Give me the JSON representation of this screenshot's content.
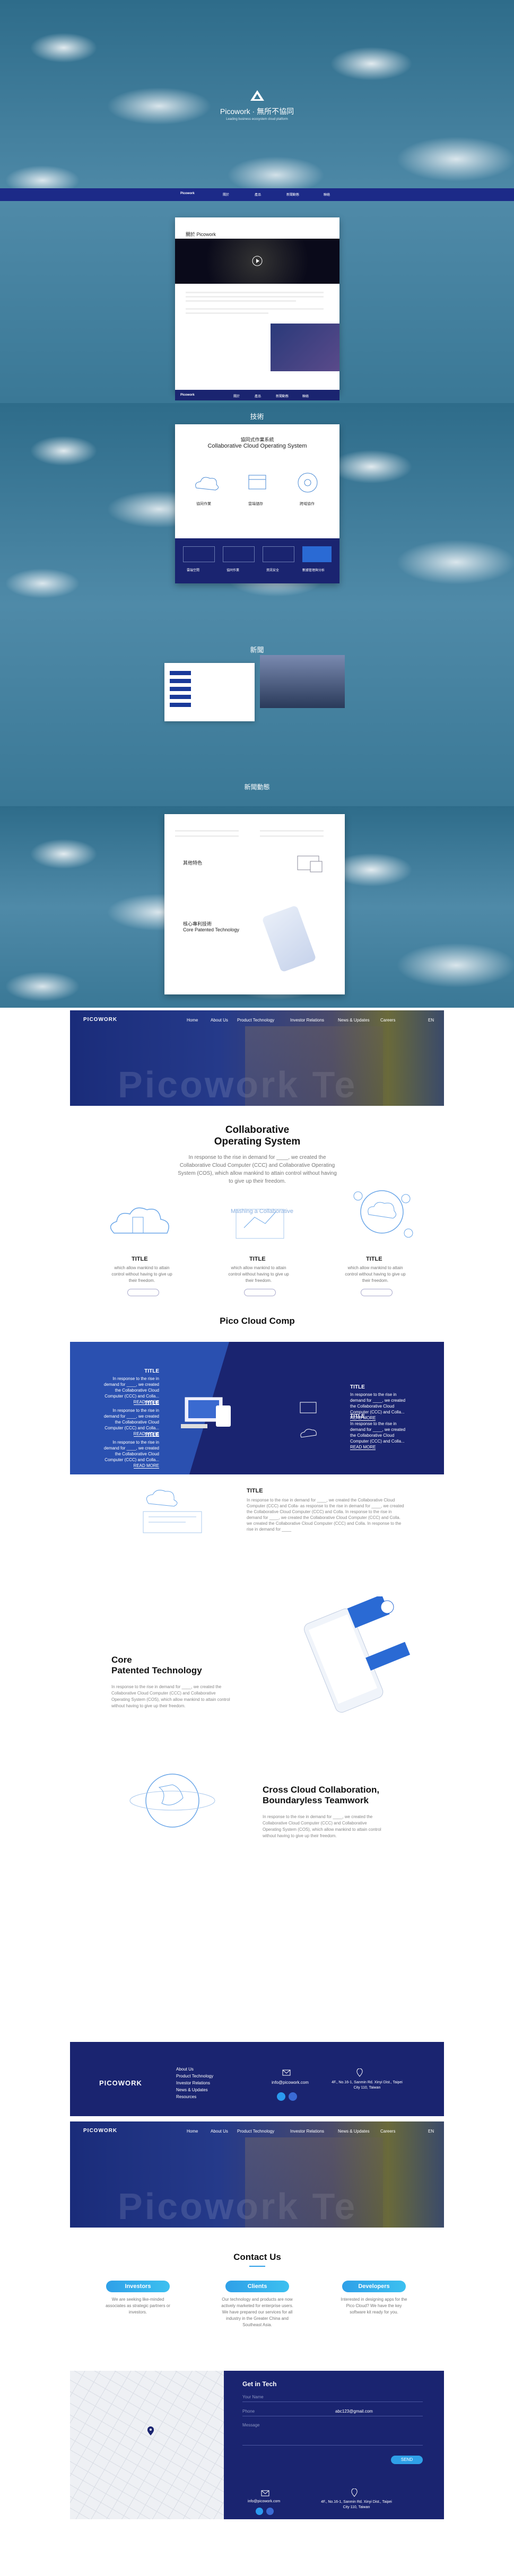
{
  "hero1": {
    "brand": "Picowork",
    "slogan": "無所不協同",
    "tagline": "Leading business ecosystem cloud platform"
  },
  "mini_nav": [
    "Picowork",
    "關於",
    "產品",
    "新聞動態",
    "聯絡"
  ],
  "about_title": "關於 Picowork",
  "tech_title": "技術",
  "cos": {
    "title_cn": "協同式作業系統",
    "title_en": "Collaborative Cloud Operating System",
    "cols": [
      "協同作業",
      "雲端儲存",
      "跨域協作"
    ],
    "tiles": [
      "雲端空間",
      "協同作業",
      "資訊安全",
      "數據管理與分析"
    ]
  },
  "news_title": "新聞",
  "news_bottom": "新聞動態",
  "mock4": {
    "h1": "其他特色",
    "h2_cn": "核心專利技術",
    "h2_en": "Core Patented Technology"
  },
  "nav": {
    "logo": "PICOWORK",
    "items": [
      "Home",
      "About Us",
      "Product Technology",
      "Investor Relations",
      "News & Updates",
      "Careers"
    ],
    "lang": "EN"
  },
  "hero_big": "Picowork Te",
  "cos2": {
    "title": "Collaborative Operating System",
    "desc": "In response to the rise in demand for ____, we created the Collaborative Cloud Computer (CCC) and Collaborative Operating System (COS), which allow mankind to attain control without having to give up their freedom.",
    "captions": [
      "Mashing a Collaborative"
    ],
    "items": [
      {
        "title": "TITLE",
        "text": "which allow mankind to attain control without having to give up their freedom."
      },
      {
        "title": "TITLE",
        "text": "which allow mankind to attain control without having to give up their freedom."
      },
      {
        "title": "TITLE",
        "text": "which allow mankind to attain control without having to give up their freedom."
      }
    ],
    "more": "MORE"
  },
  "comp": {
    "title": "Pico Cloud Comp",
    "left": [
      {
        "t": "TITLE",
        "d": "In response to the rise in demand for ____, we created the Collaborative Cloud Computer (CCC) and Colla...",
        "m": "READ MORE"
      },
      {
        "t": "TITLE",
        "d": "In response to the rise in demand for ____, we created the Collaborative Cloud Computer (CCC) and Colla...",
        "m": "READ MORE"
      },
      {
        "t": "TITLE",
        "d": "In response to the rise in demand for ____, we created the Collaborative Cloud Computer (CCC) and Colla...",
        "m": "READ MORE"
      }
    ],
    "right": [
      {
        "t": "TITLE",
        "d": "In response to the rise in demand for ____, we created the Collaborative Cloud Computer (CCC) and Colla...",
        "m": "READ MORE"
      },
      {
        "t": "TITLE",
        "d": "In response to the rise in demand for ____, we created the Collaborative Cloud Computer (CCC) and Colla...",
        "m": "READ MORE"
      }
    ],
    "detail_title": "TITLE",
    "detail_text": "In response to the rise in demand for ____, we created the Collaborative Cloud Computer (CCC) and Colla- as response to the rise in demand for ____, we created the Collaborative Cloud Computer (CCC) and Colla. In response to the rise in demand for ____, we created the Collaborative Cloud Computer (CCC) and Colla. we created the Collaborative Cloud Computer (CCC) and Colla. In response to the rise in demand for ____"
  },
  "core": {
    "title1": "Core",
    "title2": "Patented Technology",
    "text": "In response to the rise in demand for ____, we created the Collaborative Cloud Computer (CCC) and Collaborative Operating System (COS), which allow mankind to attain control without having to give up their freedom."
  },
  "cross": {
    "title1": "Cross Cloud Collaboration,",
    "title2": "Boundaryless Teamwork",
    "text": "In response to the rise in demand for ____, we created the Collaborative Cloud Computer (CCC) and Collaborative Operating System (COS), which allow mankind to attain control without having to give up their freedom."
  },
  "footer": {
    "logo": "PICOWORK",
    "links": [
      "About Us",
      "Product Technology",
      "Investor Relations",
      "News & Updates",
      "Resources"
    ],
    "email": "info@picowork.com",
    "address": "4F., No.16-1, Sanmin Rd. Xinyi Dist., Taipei City 110, Taiwan"
  },
  "contact": {
    "title": "Contact Us",
    "cards": [
      {
        "label": "Investors",
        "text": "We are seeking like-minded associates as strategic partners or investors."
      },
      {
        "label": "Clients",
        "text": "Our technology and products are now actively marketed for enterprise users. We have prepared our services for all industry in the Greater China and Southeast Asia."
      },
      {
        "label": "Developers",
        "text": "Interested in designing apps for the Pico Cloud? We have the key software kit ready for you."
      }
    ],
    "form_title": "Get in Tech",
    "fields": [
      "Your Name",
      "Phone",
      "Message"
    ],
    "email_value": "abc123@gmail.com",
    "send": "SEND",
    "email": "info@picowork.com",
    "address": "4F., No.16-1, Sanmin Rd. Xinyi Dist., Taipei City 110, Taiwan"
  }
}
